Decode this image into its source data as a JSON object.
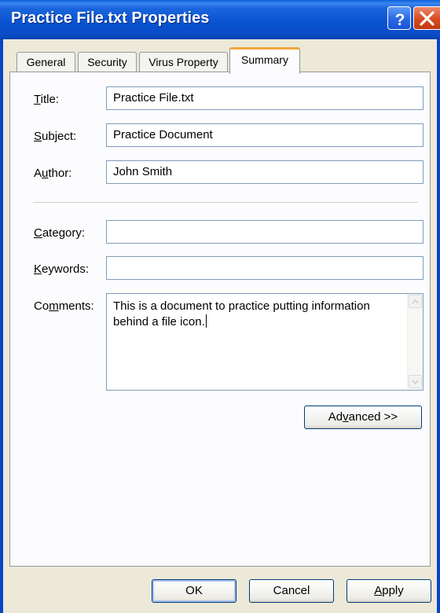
{
  "window": {
    "title": "Practice File.txt Properties",
    "help_symbol": "?",
    "accent_color": "#0a4cc6"
  },
  "tabs": [
    {
      "label": "General",
      "active": false
    },
    {
      "label": "Security",
      "active": false
    },
    {
      "label": "Virus Property",
      "active": false
    },
    {
      "label": "Summary",
      "active": true
    }
  ],
  "fields": {
    "title": {
      "label_key": "T",
      "label_rest": "itle:",
      "value": "Practice File.txt"
    },
    "subject": {
      "label_key": "S",
      "label_rest": "ubject:",
      "value": "Practice Document"
    },
    "author": {
      "label_pre": "A",
      "label_key": "u",
      "label_rest": "thor:",
      "value": "John Smith"
    },
    "category": {
      "label_key": "C",
      "label_rest": "ategory:",
      "value": ""
    },
    "keywords": {
      "label_key": "K",
      "label_rest": "eywords:",
      "value": ""
    },
    "comments": {
      "label_pre": "Co",
      "label_key": "m",
      "label_rest": "ments:",
      "value": "This is a document to practice putting information behind a file icon."
    }
  },
  "buttons": {
    "advanced": {
      "pre": "Ad",
      "key": "v",
      "rest": "anced >>"
    },
    "ok": "OK",
    "cancel": "Cancel",
    "apply": {
      "key": "A",
      "rest": "pply"
    }
  },
  "icons": {
    "help": "help-icon",
    "close": "close-icon",
    "scroll_up": "scroll-up-arrow-icon",
    "scroll_down": "scroll-down-arrow-icon"
  }
}
